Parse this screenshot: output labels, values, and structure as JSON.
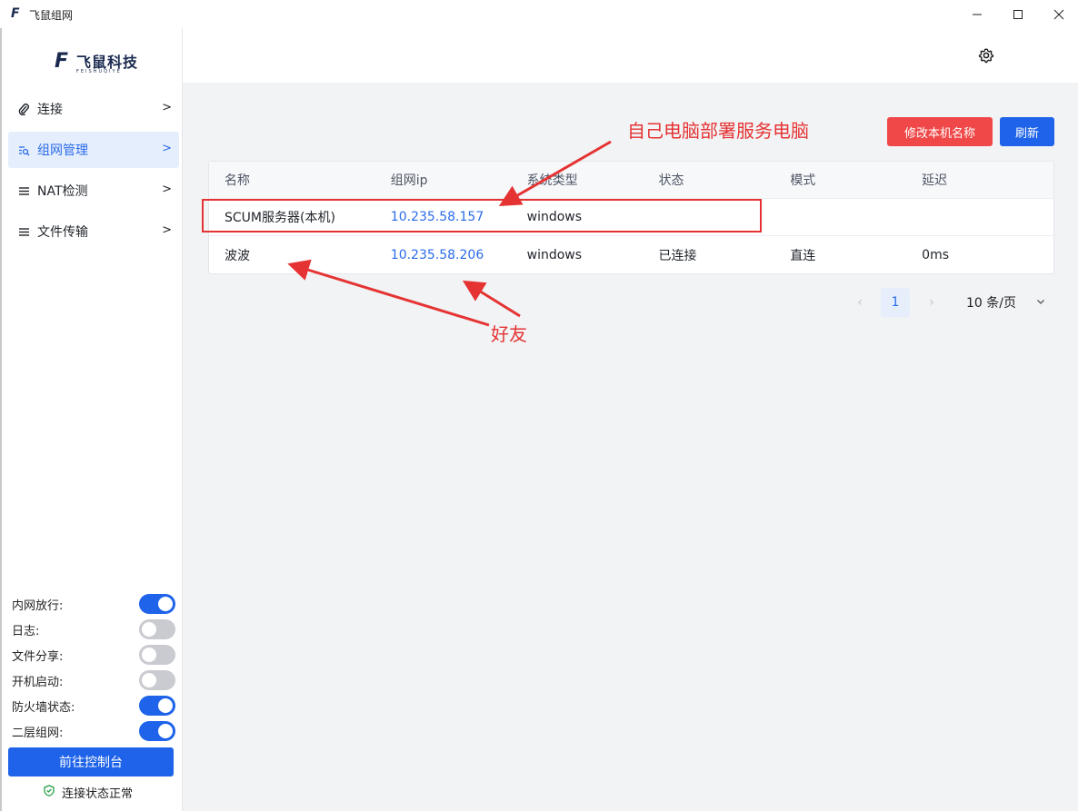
{
  "window": {
    "icon_letter": "F",
    "title": "飞鼠组网"
  },
  "logo": {
    "letter": "F",
    "name": "飞鼠科技",
    "sub": "FEISHUQIYE"
  },
  "sidebar": {
    "nav": [
      {
        "label": "连接",
        "icon": "paperclip-icon",
        "active": false
      },
      {
        "label": "组网管理",
        "icon": "network-search-icon",
        "active": true
      },
      {
        "label": "NAT检测",
        "icon": "list-icon",
        "active": false
      },
      {
        "label": "文件传输",
        "icon": "list-icon",
        "active": false
      }
    ],
    "chevron": ">",
    "toggles": [
      {
        "label": "内网放行:",
        "on": true
      },
      {
        "label": "日志:",
        "on": false
      },
      {
        "label": "文件分享:",
        "on": false
      },
      {
        "label": "开机启动:",
        "on": false
      },
      {
        "label": "防火墙状态:",
        "on": true
      },
      {
        "label": "二层组网:",
        "on": true
      }
    ],
    "console_button": "前往控制台",
    "status_text": "连接状态正常"
  },
  "toolbar": {
    "rename_button": "修改本机名称",
    "refresh_button": "刷新"
  },
  "table": {
    "headers": [
      "名称",
      "组网ip",
      "系统类型",
      "状态",
      "模式",
      "延迟"
    ],
    "rows": [
      [
        "SCUM服务器(本机)",
        "10.235.58.157",
        "windows",
        "",
        "",
        ""
      ],
      [
        "波波",
        "10.235.58.206",
        "windows",
        "已连接",
        "直连",
        "0ms"
      ]
    ]
  },
  "pagination": {
    "prev": "‹",
    "current_page": "1",
    "next": "›",
    "page_size": "10 条/页"
  },
  "annotations": {
    "top_note": "自己电脑部署服务电脑",
    "bottom_note": "好友",
    "color": "#e53333"
  },
  "colors": {
    "primary": "#1e63e9",
    "danger": "#f04848",
    "link": "#2b6bea"
  }
}
